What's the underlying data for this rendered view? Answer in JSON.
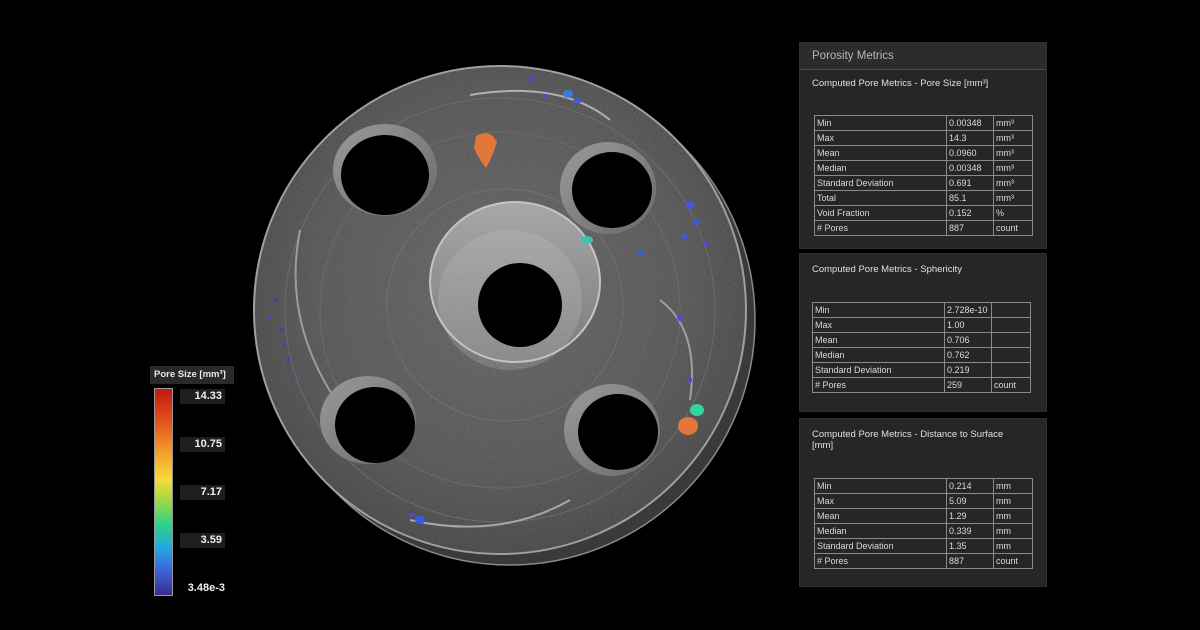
{
  "legend": {
    "title": "Pore Size [mm³]",
    "ticks": [
      "14.33",
      "10.75",
      "7.17",
      "3.59",
      "3.48e-3"
    ]
  },
  "panels": {
    "main_title": "Porosity Metrics",
    "pore_size": {
      "title": "Computed Pore Metrics - Pore Size [mm³]",
      "rows": [
        {
          "label": "Min",
          "value": "0.00348",
          "unit": "mm³"
        },
        {
          "label": "Max",
          "value": "14.3",
          "unit": "mm³"
        },
        {
          "label": "Mean",
          "value": "0.0960",
          "unit": "mm³"
        },
        {
          "label": "Median",
          "value": "0.00348",
          "unit": "mm³"
        },
        {
          "label": "Standard Deviation",
          "value": "0.691",
          "unit": "mm³"
        },
        {
          "label": "Total",
          "value": "85.1",
          "unit": "mm³"
        },
        {
          "label": "Void Fraction",
          "value": "0.152",
          "unit": "%"
        },
        {
          "label": "# Pores",
          "value": "887",
          "unit": "count"
        }
      ]
    },
    "sphericity": {
      "title": "Computed Pore Metrics - Sphericity",
      "rows": [
        {
          "label": "Min",
          "value": "2.728e-10",
          "unit": ""
        },
        {
          "label": "Max",
          "value": "1.00",
          "unit": ""
        },
        {
          "label": "Mean",
          "value": "0.706",
          "unit": ""
        },
        {
          "label": "Median",
          "value": "0.762",
          "unit": ""
        },
        {
          "label": "Standard Deviation",
          "value": "0.219",
          "unit": ""
        },
        {
          "label": "# Pores",
          "value": "259",
          "unit": "count"
        }
      ]
    },
    "distance": {
      "title": "Computed Pore Metrics - Distance to Surface [mm]",
      "rows": [
        {
          "label": "Min",
          "value": "0.214",
          "unit": "mm"
        },
        {
          "label": "Max",
          "value": "5.09",
          "unit": "mm"
        },
        {
          "label": "Mean",
          "value": "1.29",
          "unit": "mm"
        },
        {
          "label": "Median",
          "value": "0.339",
          "unit": "mm"
        },
        {
          "label": "Standard Deviation",
          "value": "1.35",
          "unit": "mm"
        },
        {
          "label": "# Pores",
          "value": "887",
          "unit": "count"
        }
      ]
    }
  },
  "colors": {
    "background": "#000000",
    "panel": "#262626",
    "pore_large": "#e2773a",
    "pore_medium": "#35d49a",
    "pore_small": "#3a5be0"
  }
}
